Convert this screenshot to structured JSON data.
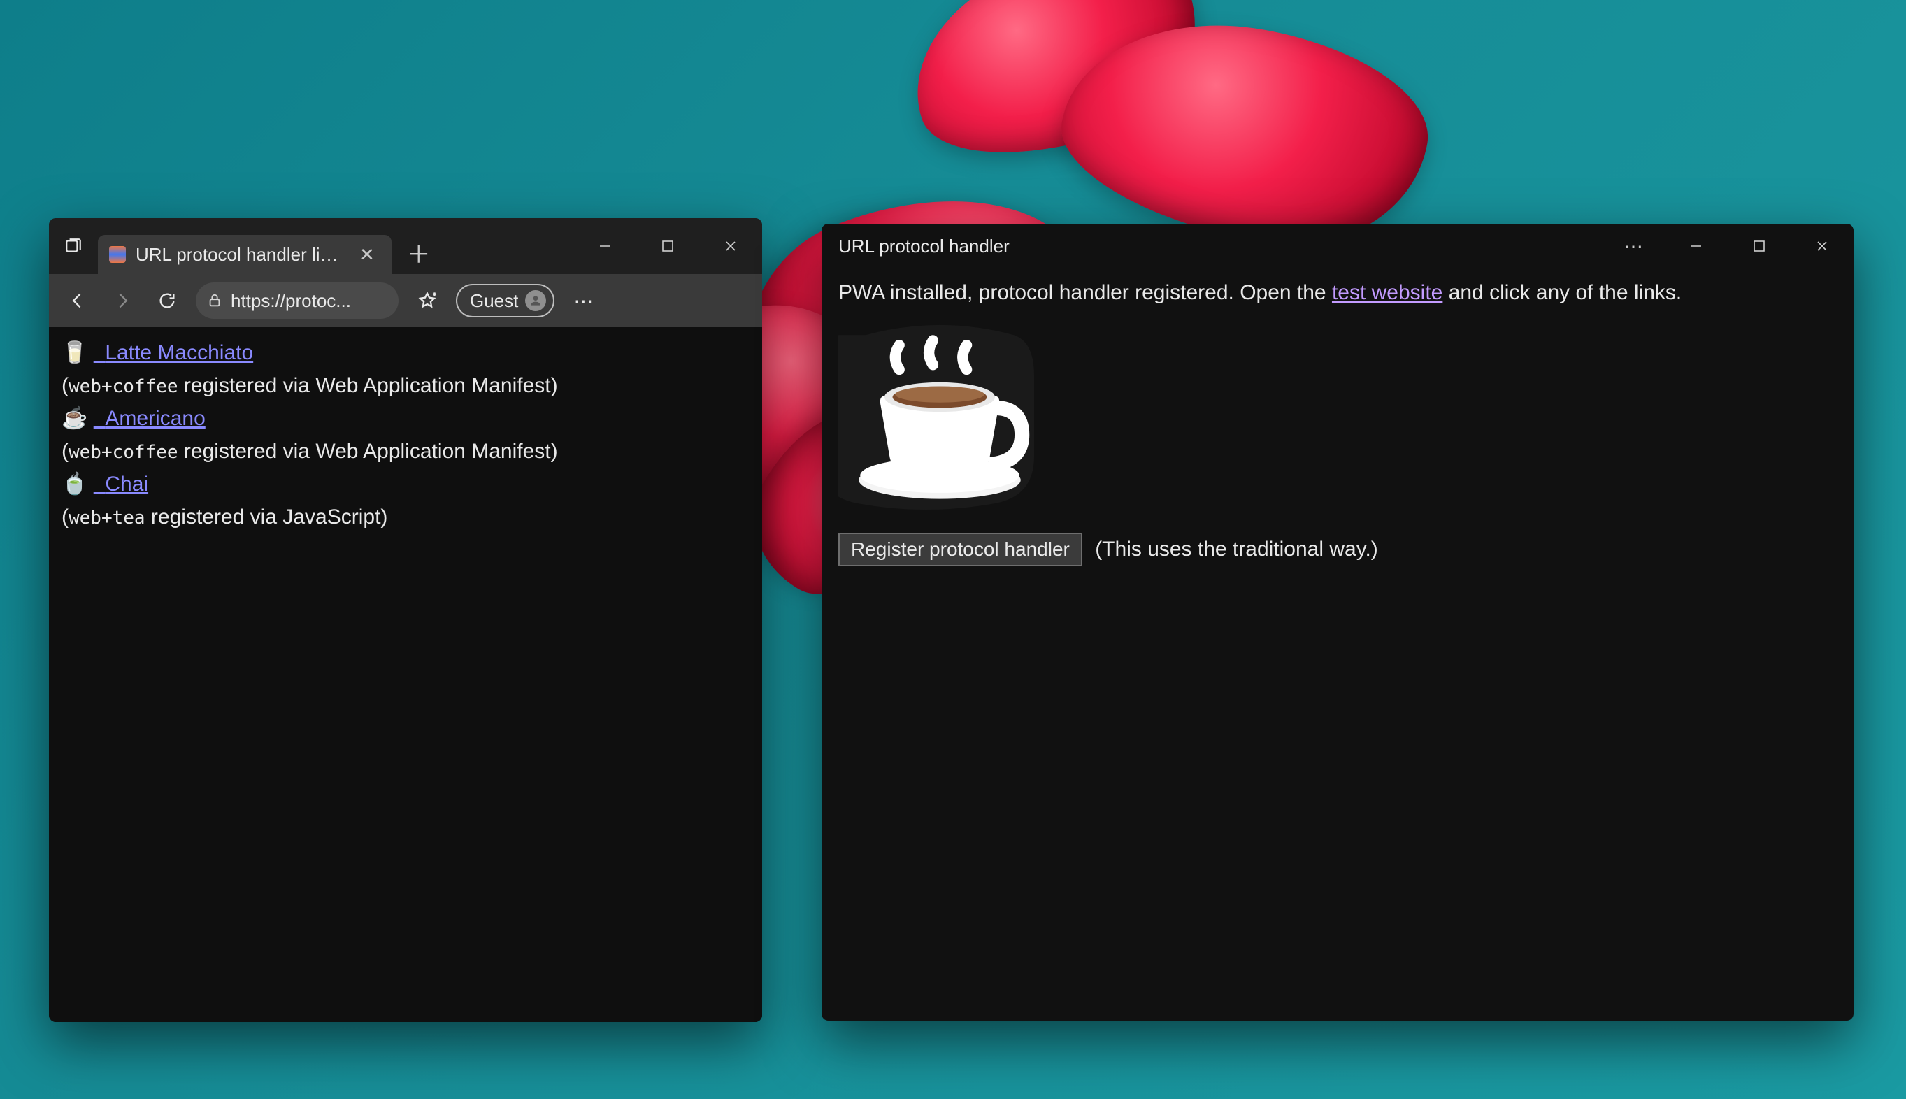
{
  "browser": {
    "tab_title": "URL protocol handler links",
    "address_text": "https://protoc...",
    "guest_label": "Guest",
    "links": [
      {
        "emoji": "🥛",
        "label": "Latte Macchiato",
        "protocol": "web+coffee",
        "source": "registered via Web Application Manifest"
      },
      {
        "emoji": "☕",
        "label": "Americano",
        "protocol": "web+coffee",
        "source": "registered via Web Application Manifest"
      },
      {
        "emoji": "🍵",
        "label": "Chai",
        "protocol": "web+tea",
        "source": "registered via JavaScript"
      }
    ]
  },
  "pwa": {
    "title": "URL protocol handler",
    "status_prefix": "PWA installed, protocol handler registered. Open the ",
    "status_link": "test website",
    "status_suffix": " and click any of the links.",
    "button_label": "Register protocol handler",
    "button_note": "(This uses the traditional way.)"
  }
}
